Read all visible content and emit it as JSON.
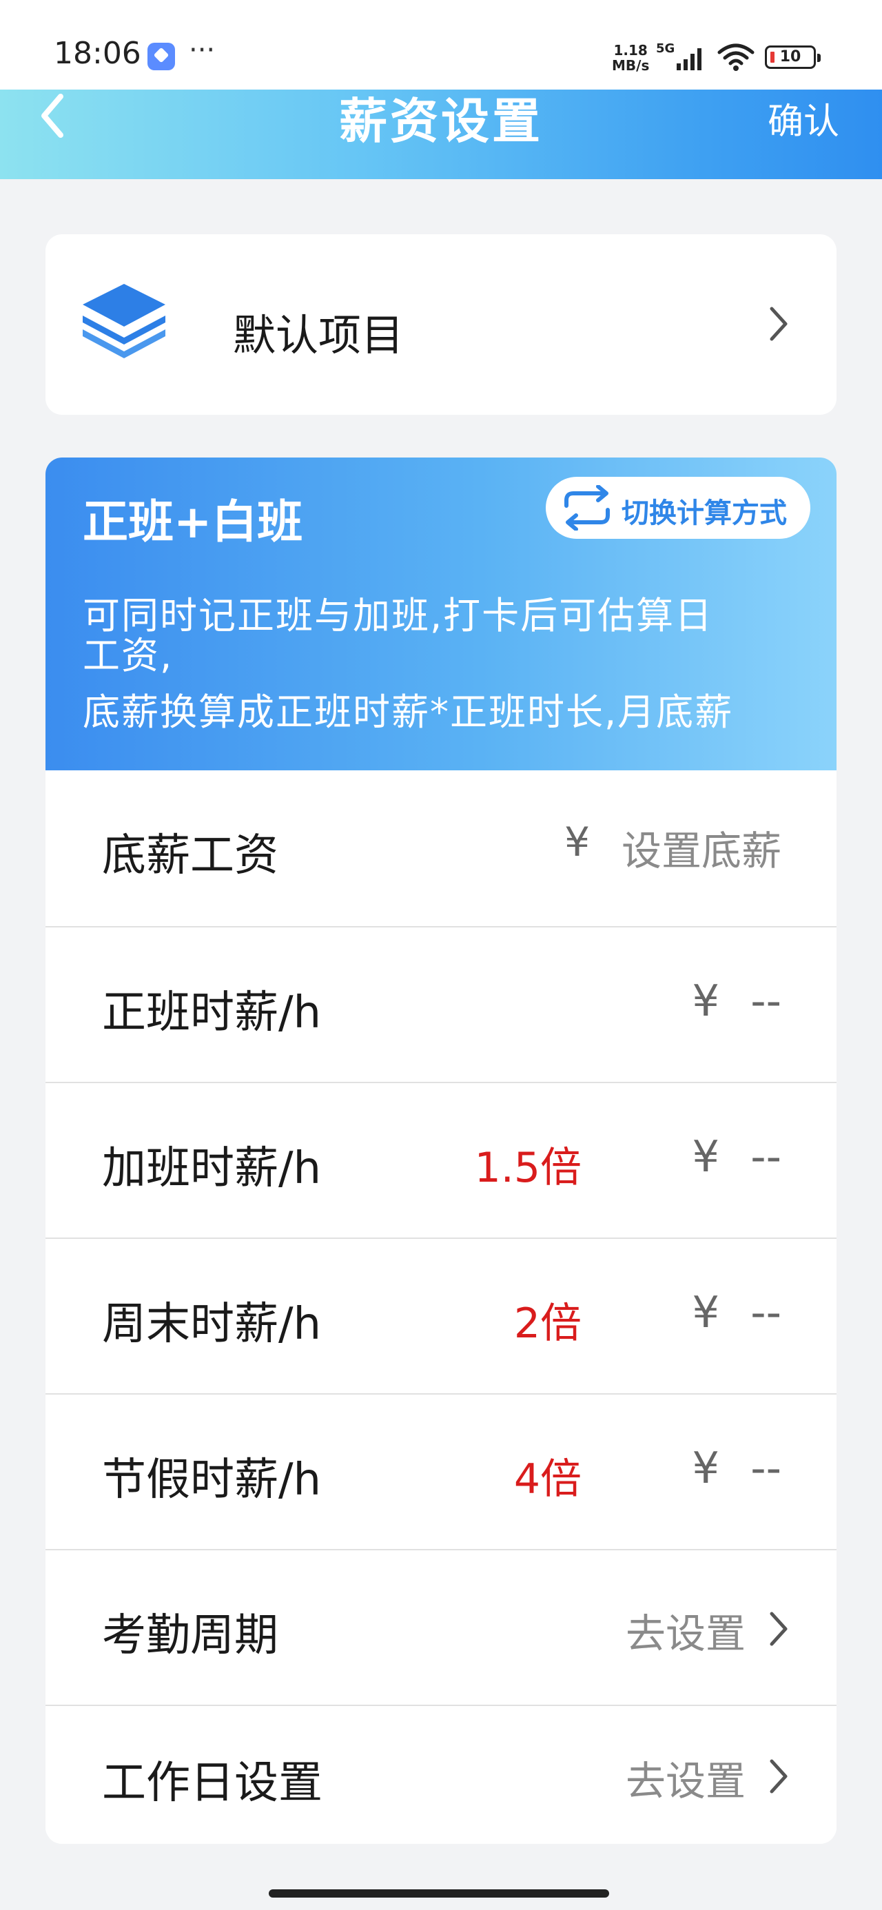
{
  "status_bar": {
    "time": "18:06",
    "more": "···",
    "net_speed_value": "1.18",
    "net_speed_unit": "MB/s",
    "network": "5G",
    "battery": "10"
  },
  "header": {
    "title": "薪资设置",
    "confirm_label": "确认",
    "back_icon": "chevron-left-icon",
    "background_start": "#8de2f0",
    "background_end": "#2f8ff0"
  },
  "default_items": {
    "label": "默认项目",
    "icon": "layers-stack-icon",
    "icon_color": "#2d7fe6"
  },
  "mode_banner": {
    "title": "正班+白班",
    "switch_label": "切换计算方式",
    "description_line1": "可同时记正班与加班,打卡后可估算日",
    "description_line2": "工资,",
    "description_line3": "底薪换算成正班时薪*正班时长,月底薪"
  },
  "rows": {
    "base_salary": {
      "label": "底薪工资",
      "currency": "¥",
      "placeholder": "设置底薪"
    },
    "regular_rate": {
      "label": "正班时薪/h",
      "currency": "¥",
      "value": "--"
    },
    "overtime_rate": {
      "label": "加班时薪/h",
      "multiplier": "1.5倍",
      "currency": "¥",
      "value": "--"
    },
    "weekend_rate": {
      "label": "周末时薪/h",
      "multiplier": "2倍",
      "currency": "¥",
      "value": "--"
    },
    "holiday_rate": {
      "label": "节假时薪/h",
      "multiplier": "4倍",
      "currency": "¥",
      "value": "--"
    },
    "attendance_cycle": {
      "label": "考勤周期",
      "action": "去设置"
    },
    "workday_settings": {
      "label": "工作日设置",
      "action": "去设置"
    }
  },
  "colors": {
    "accent": "#2f86e8",
    "multiplier": "#d91c1c",
    "page_background": "#f2f3f5"
  }
}
